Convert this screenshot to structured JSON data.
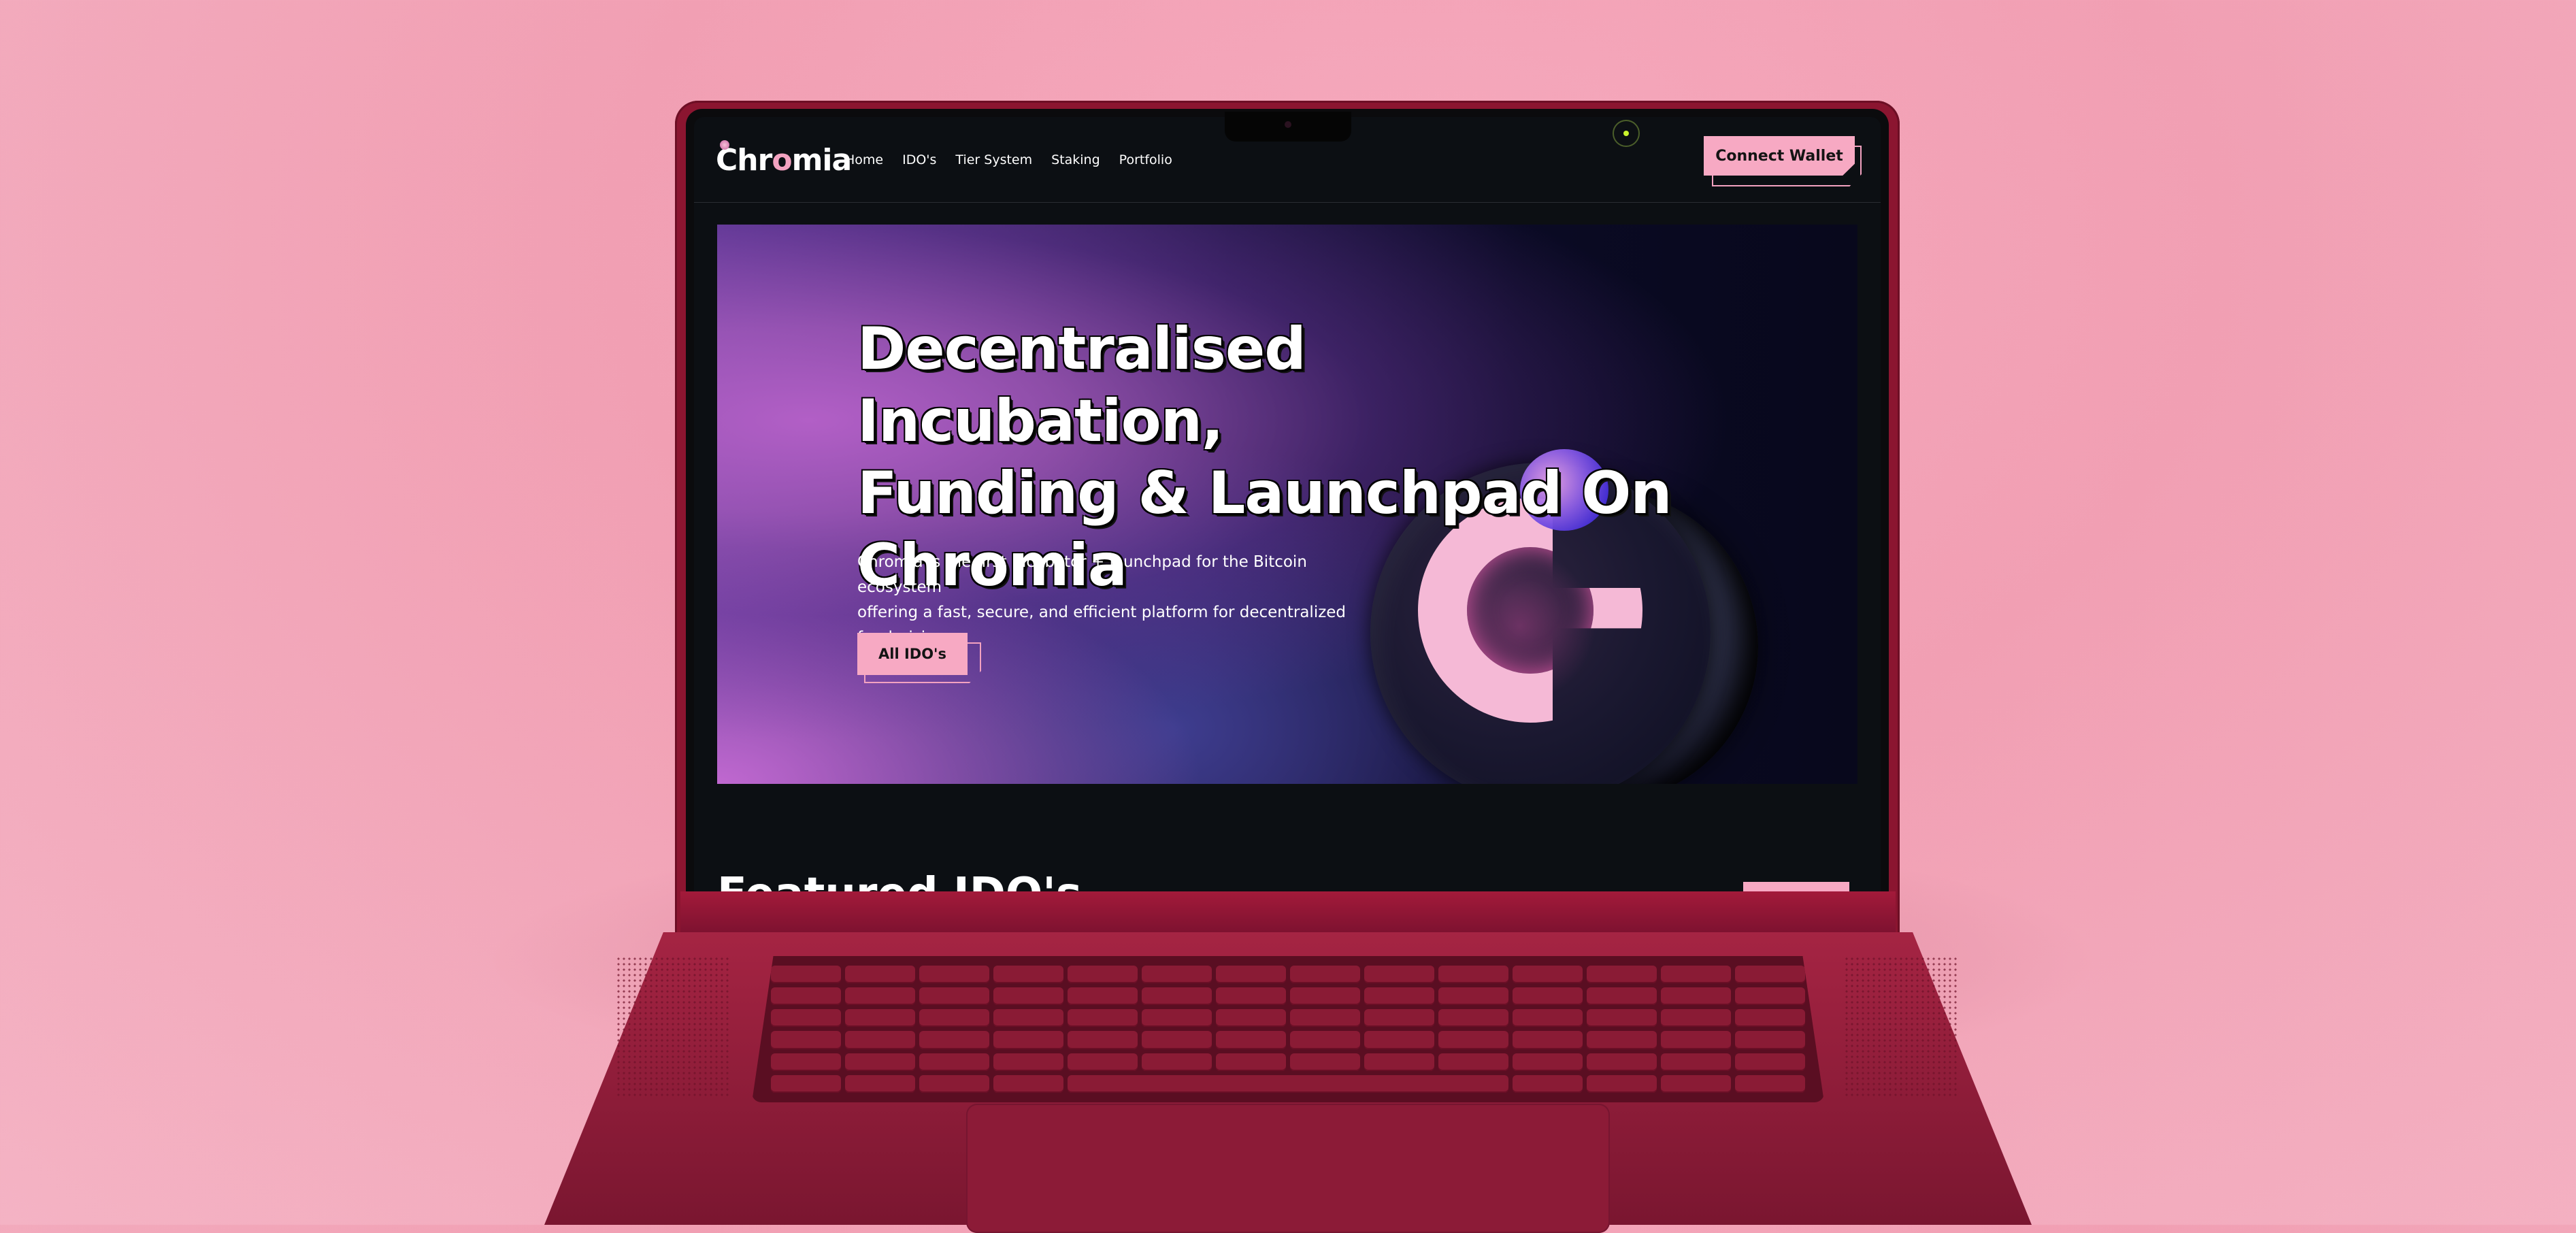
{
  "brand": {
    "name_part1": "Chr",
    "name_part2": "o",
    "name_part3": "mia"
  },
  "nav": {
    "items": [
      "Home",
      "IDO's",
      "Tier System",
      "Staking",
      "Portfolio"
    ],
    "connect_label": "Connect Wallet"
  },
  "hero": {
    "title_line1": "Decentralised Incubation,",
    "title_line2": "Funding & Launchpad On",
    "title_line3": "Chromia",
    "description_line1": "Chromia is the first Incubator + launchpad for the Bitcoin ecosystem",
    "description_line2": "offering a fast, secure, and efficient platform for decentralized fundraising.",
    "cta_label": "All IDO's"
  },
  "section": {
    "featured_title": "Featured IDO's"
  },
  "colors": {
    "accent_pink": "#f7a9c3",
    "screen_bg": "#0c0f13",
    "status_green": "#c9f32c",
    "laptop_body": "#8b1530"
  },
  "icons": {
    "status": "status-dot-icon",
    "logo_art": "chromia-c-logo-icon"
  }
}
